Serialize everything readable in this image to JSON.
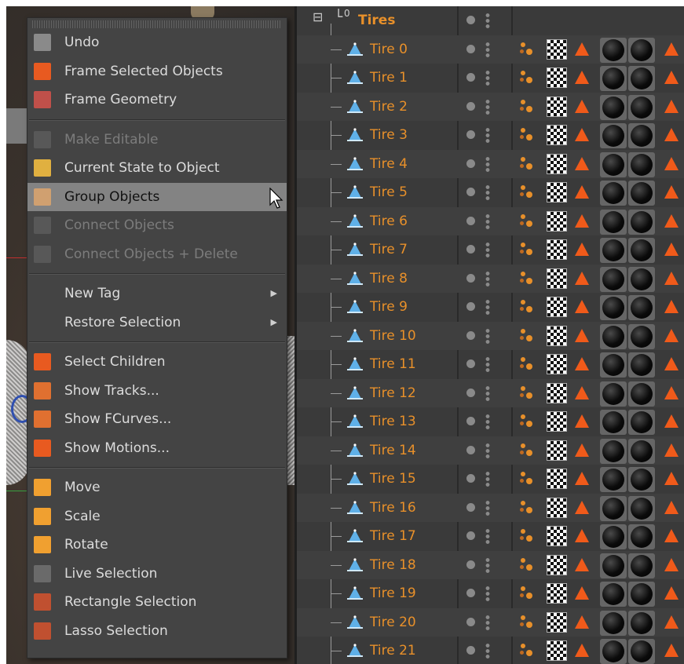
{
  "menu": {
    "items": [
      {
        "label": "Undo",
        "icon": "undo-icon",
        "icon_color": "#8a8a8a",
        "state": "normal"
      },
      {
        "label": "Frame Selected Objects",
        "icon": "frame-selected-icon",
        "icon_color": "#e85a20",
        "state": "normal"
      },
      {
        "label": "Frame Geometry",
        "icon": "frame-geometry-icon",
        "icon_color": "#c0504a",
        "state": "normal"
      },
      {
        "sep": true
      },
      {
        "label": "Make Editable",
        "icon": "make-editable-icon",
        "icon_color": "#6a6a6a",
        "state": "disabled"
      },
      {
        "label": "Current State to Object",
        "icon": "current-state-icon",
        "icon_color": "#e0b040",
        "state": "normal"
      },
      {
        "label": "Group Objects",
        "icon": "group-objects-icon",
        "icon_color": "#d0a070",
        "state": "hover"
      },
      {
        "label": "Connect Objects",
        "icon": "connect-objects-icon",
        "icon_color": "#6a6a6a",
        "state": "disabled"
      },
      {
        "label": "Connect Objects + Delete",
        "icon": "connect-delete-icon",
        "icon_color": "#6a6a6a",
        "state": "disabled"
      },
      {
        "sep": true
      },
      {
        "label": "New Tag",
        "icon": "",
        "icon_color": "",
        "state": "normal",
        "submenu": true
      },
      {
        "label": "Restore Selection",
        "icon": "",
        "icon_color": "",
        "state": "normal",
        "submenu": true
      },
      {
        "sep": true
      },
      {
        "label": "Select Children",
        "icon": "select-children-icon",
        "icon_color": "#e85a20",
        "state": "normal"
      },
      {
        "label": "Show Tracks...",
        "icon": "show-tracks-icon",
        "icon_color": "#e07030",
        "state": "normal"
      },
      {
        "label": "Show FCurves...",
        "icon": "show-fcurves-icon",
        "icon_color": "#e07030",
        "state": "normal"
      },
      {
        "label": "Show Motions...",
        "icon": "show-motions-icon",
        "icon_color": "#e85a20",
        "state": "normal"
      },
      {
        "sep": true
      },
      {
        "label": "Move",
        "icon": "move-icon",
        "icon_color": "#f0a030",
        "state": "normal"
      },
      {
        "label": "Scale",
        "icon": "scale-icon",
        "icon_color": "#f0a030",
        "state": "normal"
      },
      {
        "label": "Rotate",
        "icon": "rotate-icon",
        "icon_color": "#f0a030",
        "state": "normal"
      },
      {
        "label": "Live Selection",
        "icon": "live-selection-icon",
        "icon_color": "#6a6a6a",
        "state": "normal"
      },
      {
        "label": "Rectangle Selection",
        "icon": "rectangle-selection-icon",
        "icon_color": "#c05030",
        "state": "normal"
      },
      {
        "label": "Lasso Selection",
        "icon": "lasso-selection-icon",
        "icon_color": "#c05030",
        "state": "normal"
      }
    ]
  },
  "object_manager": {
    "parent": {
      "name": "Tires",
      "layer": "0"
    },
    "children": [
      "Tire 0",
      "Tire 1",
      "Tire 2",
      "Tire 3",
      "Tire 4",
      "Tire 5",
      "Tire 6",
      "Tire 7",
      "Tire 8",
      "Tire 9",
      "Tire 10",
      "Tire 11",
      "Tire 12",
      "Tire 13",
      "Tire 14",
      "Tire 15",
      "Tire 16",
      "Tire 17",
      "Tire 18",
      "Tire 19",
      "Tire 20",
      "Tire 21"
    ],
    "accent_color": "#e8902a",
    "tag_triangle_color": "#f05a1a"
  }
}
